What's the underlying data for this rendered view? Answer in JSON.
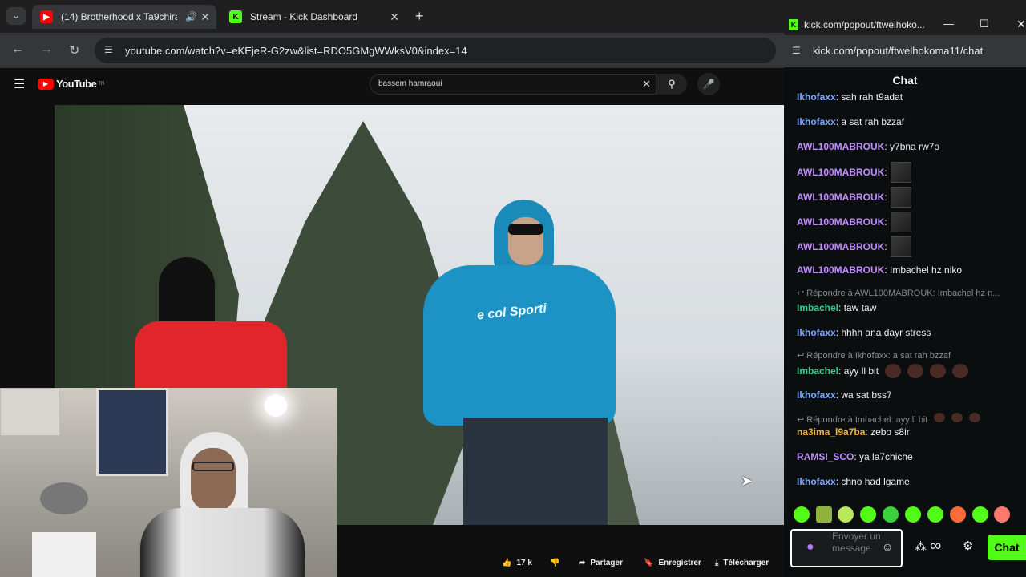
{
  "browser": {
    "tabs": [
      {
        "label": "(14) Brotherhood x Ta9chira",
        "active": true
      },
      {
        "label": "Stream - Kick Dashboard",
        "active": false
      }
    ],
    "url": "youtube.com/watch?v=eKEjeR-G2zw&list=RDO5GMgWWksV0&index=14"
  },
  "youtube": {
    "logo": "YouTube",
    "logo_suffix": "TN",
    "search_value": "bassem hamraoui",
    "video": {
      "overlay_text": "e col Sporti"
    },
    "actions": {
      "likes": "17 k",
      "share": "Partager",
      "save": "Enregistrer",
      "download": "Télécharger"
    }
  },
  "kick": {
    "window_title": "kick.com/popout/ftwelhoko...",
    "url": "kick.com/popout/ftwelhokoma11/chat",
    "chat_title": "Chat",
    "messages": [
      {
        "user": "Ikhofaxx",
        "color": "#7aa7ff",
        "text": "sah rah t9adat"
      },
      {
        "user": "Ikhofaxx",
        "color": "#7aa7ff",
        "text": "a sat rah bzzaf"
      },
      {
        "user": "AWL100MABROUK",
        "color": "#c08cff",
        "text": "y7bna rw7o"
      },
      {
        "user": "AWL100MABROUK",
        "color": "#c08cff",
        "text": ""
      },
      {
        "user": "AWL100MABROUK",
        "color": "#c08cff",
        "text": ""
      },
      {
        "user": "AWL100MABROUK",
        "color": "#c08cff",
        "text": ""
      },
      {
        "user": "AWL100MABROUK",
        "color": "#c08cff",
        "text": ""
      },
      {
        "user": "AWL100MABROUK",
        "color": "#c08cff",
        "text": "Imbachel hz niko"
      },
      {
        "reply": "Répondre à AWL100MABROUK: Imbachel hz n..."
      },
      {
        "user": "Imbachel",
        "color": "#2fd18c",
        "text": "taw taw"
      },
      {
        "user": "Ikhofaxx",
        "color": "#7aa7ff",
        "text": "hhhh ana dayr stress"
      },
      {
        "reply": "Répondre à Ikhofaxx: a sat rah bzzaf"
      },
      {
        "user": "Imbachel",
        "color": "#2fd18c",
        "text": "ayy ll bit"
      },
      {
        "user": "Ikhofaxx",
        "color": "#7aa7ff",
        "text": "wa sat bss7"
      },
      {
        "reply": "Répondre à Imbachel: ayy ll bit"
      },
      {
        "user": "na3ima_l9a7ba",
        "color": "#f2b13c",
        "text": "zebo s8ir"
      },
      {
        "user": "RAMSI_SCO",
        "color": "#c08cff",
        "text": "ya la7chiche"
      },
      {
        "user": "Ikhofaxx",
        "color": "#7aa7ff",
        "text": "chno had lgame"
      }
    ],
    "composer_placeholder": "Envoyer un message",
    "send_label": "Chat"
  }
}
